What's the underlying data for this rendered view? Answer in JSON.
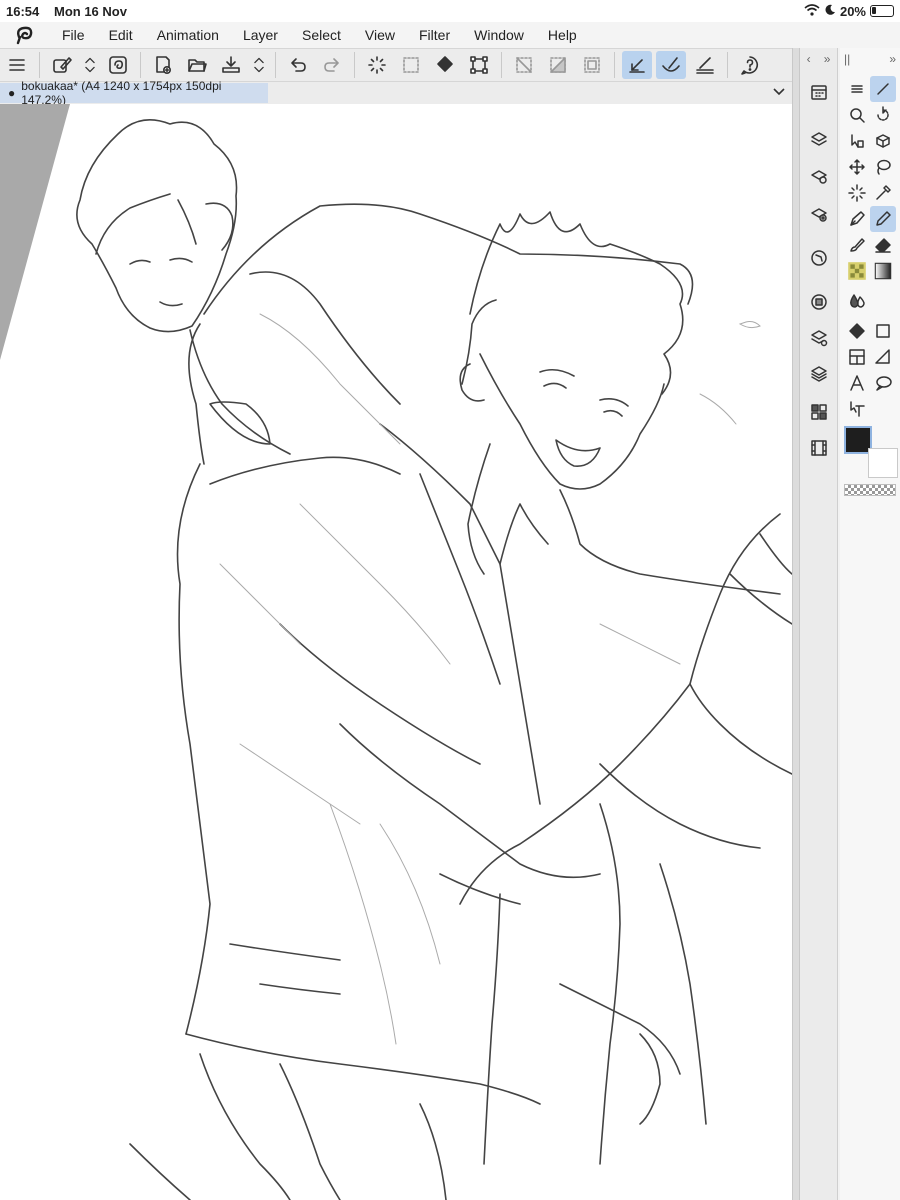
{
  "status_bar": {
    "time": "16:54",
    "date": "Mon 16 Nov",
    "battery": "20%"
  },
  "menu": {
    "items": [
      "File",
      "Edit",
      "Animation",
      "Layer",
      "Select",
      "View",
      "Filter",
      "Window",
      "Help"
    ]
  },
  "document_tab": {
    "title": "bokuakaa* (A4 1240 x 1754px 150dpi 147.2%)"
  },
  "colors": {
    "main_color": "#1e1e1e",
    "sub_color": "#ffffff",
    "selection_highlight": "#bcd3ee"
  }
}
